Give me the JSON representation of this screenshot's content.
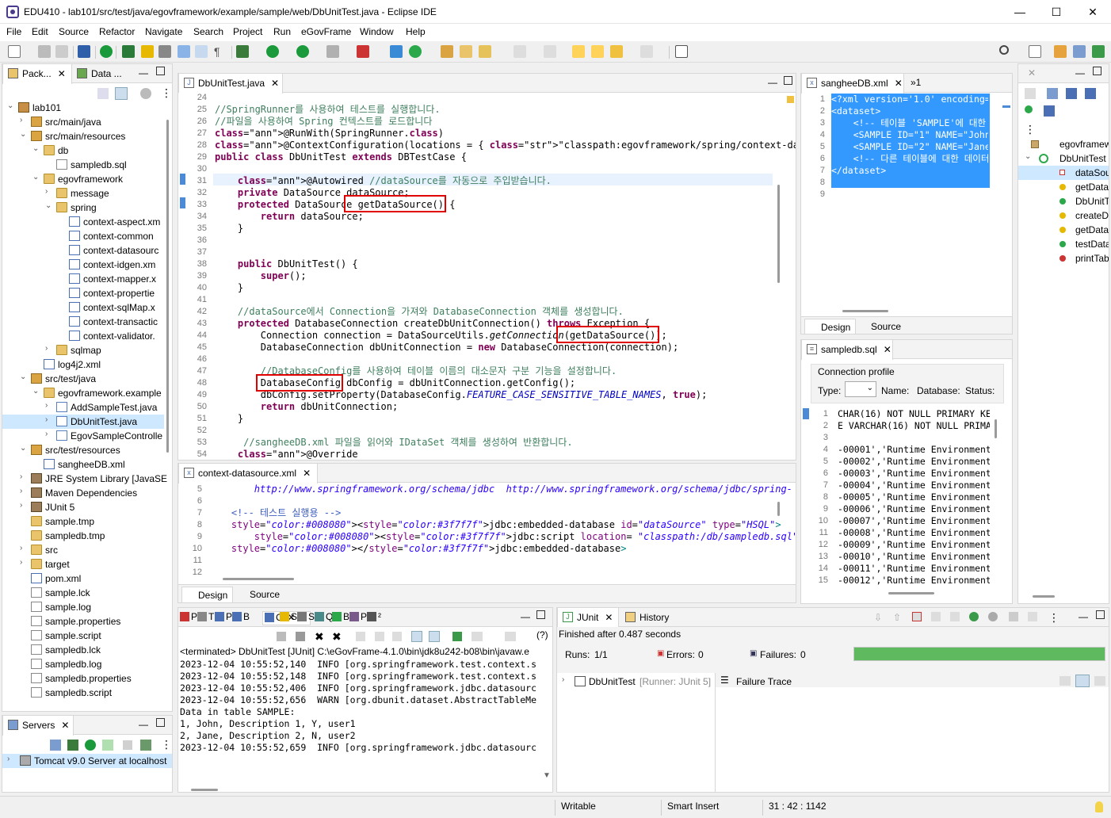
{
  "window": {
    "title": "EDU410 - lab101/src/test/java/egovframework/example/sample/web/DbUnitTest.java - Eclipse IDE",
    "minimize": "—",
    "maximize": "☐",
    "close": "✕"
  },
  "menu": [
    "File",
    "Edit",
    "Source",
    "Refactor",
    "Navigate",
    "Search",
    "Project",
    "Run",
    "eGovFrame",
    "Window",
    "Help"
  ],
  "explorer": {
    "tabs": [
      "Pack...",
      "Data ..."
    ],
    "items": [
      {
        "label": "lab101"
      },
      {
        "label": "src/main/java"
      },
      {
        "label": "src/main/resources"
      },
      {
        "label": "db"
      },
      {
        "label": "sampledb.sql"
      },
      {
        "label": "egovframework"
      },
      {
        "label": "message"
      },
      {
        "label": "spring"
      },
      {
        "label": "context-aspect.xm"
      },
      {
        "label": "context-common"
      },
      {
        "label": "context-datasourc"
      },
      {
        "label": "context-idgen.xm"
      },
      {
        "label": "context-mapper.x"
      },
      {
        "label": "context-propertie"
      },
      {
        "label": "context-sqlMap.x"
      },
      {
        "label": "context-transactic"
      },
      {
        "label": "context-validator."
      },
      {
        "label": "sqlmap"
      },
      {
        "label": "log4j2.xml"
      },
      {
        "label": "src/test/java"
      },
      {
        "label": "egovframework.example"
      },
      {
        "label": "AddSampleTest.java"
      },
      {
        "label": "DbUnitTest.java"
      },
      {
        "label": "EgovSampleControlle"
      },
      {
        "label": "src/test/resources"
      },
      {
        "label": "sangheeDB.xml"
      },
      {
        "label": "JRE System Library [JavaSE"
      },
      {
        "label": "Maven Dependencies"
      },
      {
        "label": "JUnit 5"
      },
      {
        "label": "sample.tmp"
      },
      {
        "label": "sampledb.tmp"
      },
      {
        "label": "src"
      },
      {
        "label": "target"
      },
      {
        "label": "pom.xml"
      },
      {
        "label": "sample.lck"
      },
      {
        "label": "sample.log"
      },
      {
        "label": "sample.properties"
      },
      {
        "label": "sample.script"
      },
      {
        "label": "sampledb.lck"
      },
      {
        "label": "sampledb.log"
      },
      {
        "label": "sampledb.properties"
      },
      {
        "label": "sampledb.script"
      }
    ]
  },
  "servers": {
    "tab": "Servers",
    "item": "Tomcat v9.0 Server at localhost"
  },
  "editor": {
    "tab": "DbUnitTest.java",
    "lines": [
      {
        "n": "24",
        "t": ""
      },
      {
        "n": "25",
        "t": "//SpringRunner를 사용하여 테스트를 실행합니다."
      },
      {
        "n": "26",
        "t": "//파일을 사용하여 Spring 컨텍스트를 로드합니다"
      },
      {
        "n": "27",
        "t": "@RunWith(SpringRunner.class)"
      },
      {
        "n": "28",
        "t": "@ContextConfiguration(locations = { \"classpath:egovframework/spring/context-datasource.xml\" })"
      },
      {
        "n": "29",
        "t": "public class DbUnitTest extends DBTestCase {"
      },
      {
        "n": "30",
        "t": ""
      },
      {
        "n": "31",
        "t": "    @Autowired //dataSource를 자동으로 주입받습니다."
      },
      {
        "n": "32",
        "t": "    private DataSource dataSource;"
      },
      {
        "n": "33",
        "t": "    protected DataSource getDataSource() {"
      },
      {
        "n": "34",
        "t": "        return dataSource;"
      },
      {
        "n": "35",
        "t": "    }"
      },
      {
        "n": "36",
        "t": ""
      },
      {
        "n": "37",
        "t": ""
      },
      {
        "n": "38",
        "t": "    public DbUnitTest() {"
      },
      {
        "n": "39",
        "t": "        super();"
      },
      {
        "n": "40",
        "t": "    }"
      },
      {
        "n": "41",
        "t": ""
      },
      {
        "n": "42",
        "t": "    //dataSource에서 Connection을 가져와 DatabaseConnection 객체를 생성합니다."
      },
      {
        "n": "43",
        "t": "    protected DatabaseConnection createDbUnitConnection() throws Exception {"
      },
      {
        "n": "44",
        "t": "        Connection connection = DataSourceUtils.getConnection(getDataSource());"
      },
      {
        "n": "45",
        "t": "        DatabaseConnection dbUnitConnection = new DatabaseConnection(connection);"
      },
      {
        "n": "46",
        "t": ""
      },
      {
        "n": "47",
        "t": "        //DatabaseConfig를 사용하여 테이블 이름의 대소문자 구분 기능을 설정합니다."
      },
      {
        "n": "48",
        "t": "        DatabaseConfig dbConfig = dbUnitConnection.getConfig();"
      },
      {
        "n": "49",
        "t": "        dbConfig.setProperty(DatabaseConfig.FEATURE_CASE_SENSITIVE_TABLE_NAMES, true);"
      },
      {
        "n": "50",
        "t": "        return dbUnitConnection;"
      },
      {
        "n": "51",
        "t": "    }"
      },
      {
        "n": "52",
        "t": ""
      },
      {
        "n": "53",
        "t": "     //sangheeDB.xml 파일을 읽어와 IDataSet 객체를 생성하여 반환합니다."
      },
      {
        "n": "54",
        "t": "    @Override"
      }
    ]
  },
  "context_editor": {
    "tab": "context-datasource.xml",
    "lines": [
      {
        "n": "5",
        "t": "        http://www.springframework.org/schema/jdbc  http://www.springframework.org/schema/jdbc/spring-"
      },
      {
        "n": "6",
        "t": ""
      },
      {
        "n": "7",
        "t": "    <!-- 테스트 실행용 -->"
      },
      {
        "n": "8",
        "t": "    <jdbc:embedded-database id=\"dataSource\" type=\"HSQL\">"
      },
      {
        "n": "9",
        "t": "        <jdbc:script location= \"classpath:/db/sampledb.sql\"/>"
      },
      {
        "n": "10",
        "t": "    </jdbc:embedded-database>"
      },
      {
        "n": "11",
        "t": ""
      },
      {
        "n": "12",
        "t": ""
      }
    ],
    "bottom_tabs": [
      "Design",
      "Source"
    ]
  },
  "xml_editor": {
    "tab": "sangheeDB.xml",
    "more": "»1",
    "lines": [
      {
        "n": "1",
        "t": "<?xml version='1.0' encoding="
      },
      {
        "n": "2",
        "t": "<dataset>"
      },
      {
        "n": "3",
        "t": "    <!-- 테이블 'SAMPLE'에 대한"
      },
      {
        "n": "4",
        "t": "    <SAMPLE ID=\"1\" NAME=\"John"
      },
      {
        "n": "5",
        "t": "    <SAMPLE ID=\"2\" NAME=\"Jane"
      },
      {
        "n": "6",
        "t": "    <!-- 다른 테이블에 대한 데이터도"
      },
      {
        "n": "7",
        "t": "</dataset>"
      },
      {
        "n": "8",
        "t": ""
      },
      {
        "n": "9",
        "t": ""
      }
    ],
    "bottom_tabs": [
      "Design",
      "Source"
    ]
  },
  "sql_editor": {
    "tab": "sampledb.sql",
    "connection_profile": "Connection profile",
    "type_label": "Type:",
    "name_label": "Name:",
    "database_label": "Database:",
    "status_label": "Status:",
    "lines": [
      {
        "n": "1",
        "t": "CHAR(16) NOT NULL PRIMARY KE"
      },
      {
        "n": "2",
        "t": "E VARCHAR(16) NOT NULL PRIMA"
      },
      {
        "n": "3",
        "t": ""
      },
      {
        "n": "4",
        "t": "-00001','Runtime Environment"
      },
      {
        "n": "5",
        "t": "-00002','Runtime Environment"
      },
      {
        "n": "6",
        "t": "-00003','Runtime Environment"
      },
      {
        "n": "7",
        "t": "-00004','Runtime Environment"
      },
      {
        "n": "8",
        "t": "-00005','Runtime Environment"
      },
      {
        "n": "9",
        "t": "-00006','Runtime Environment"
      },
      {
        "n": "10",
        "t": "-00007','Runtime Environment"
      },
      {
        "n": "11",
        "t": "-00008','Runtime Environment"
      },
      {
        "n": "12",
        "t": "-00009','Runtime Environment"
      },
      {
        "n": "13",
        "t": "-00010','Runtime Environment"
      },
      {
        "n": "14",
        "t": "-00011','Runtime Environment"
      },
      {
        "n": "15",
        "t": "-00012','Runtime Environment"
      }
    ]
  },
  "outline": {
    "items": [
      "egovframew",
      "DbUnitTest",
      "dataSour",
      "getDataS",
      "DbUnitTe",
      "createDb",
      "getDataS",
      "testDatal",
      "printTabl"
    ]
  },
  "console": {
    "tabs": [
      "P",
      "T",
      "P",
      "B",
      "C",
      "S",
      "S",
      "Q",
      "B",
      "P",
      "²"
    ],
    "header": "<terminated> DbUnitTest [JUnit] C:\\eGovFrame-4.1.0\\bin\\jdk8u242-b08\\bin\\javaw.e",
    "lines": [
      "2023-12-04 10:55:52,140  INFO [org.springframework.test.context.s",
      "2023-12-04 10:55:52,148  INFO [org.springframework.test.context.s",
      "2023-12-04 10:55:52,406  INFO [org.springframework.jdbc.datasourc",
      "2023-12-04 10:55:52,656  WARN [org.dbunit.dataset.AbstractTableMe",
      "Data in table SAMPLE:",
      "1, John, Description 1, Y, user1",
      "2, Jane, Description 2, N, user2",
      "2023-12-04 10:55:52,659  INFO [org.springframework.jdbc.datasourc"
    ]
  },
  "junit": {
    "tab": "JUnit",
    "history_tab": "History",
    "finished": "Finished after 0.487 seconds",
    "runs_label": "Runs:",
    "runs_value": "1/1",
    "errors_label": "Errors:",
    "errors_value": "0",
    "failures_label": "Failures:",
    "failures_value": "0",
    "progress": 1.0,
    "bar_color": "#5fb95f",
    "test_name": "DbUnitTest",
    "runner": "[Runner: JUnit 5]",
    "failure_trace": "Failure Trace"
  },
  "status": {
    "writable": "Writable",
    "insert_mode": "Smart Insert",
    "position": "31 : 42 : 1142"
  },
  "colors": {
    "selection": "#3399ff",
    "highlight_box": "#e00000",
    "tree_selected": "#cde8ff"
  }
}
